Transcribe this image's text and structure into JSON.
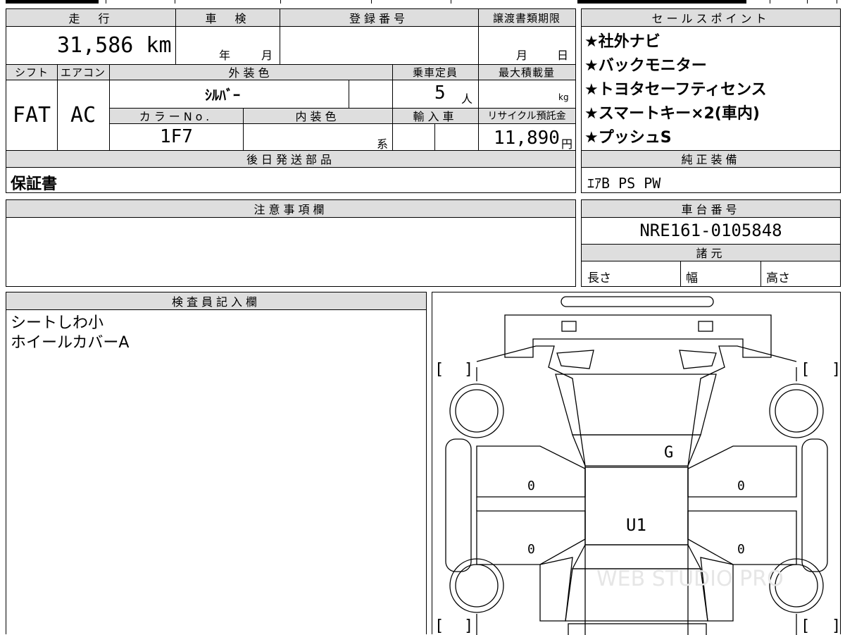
{
  "top_strip": {
    "dark_tab": ""
  },
  "vehicle": {
    "mileage_label": "走　行",
    "mileage_value": "31,586 km",
    "inspection_label": "車　検",
    "inspection_year_unit": "年",
    "inspection_month_unit": "月",
    "registration_label": "登録番号",
    "registration_value": "",
    "transfer_label": "譲渡書類期限",
    "transfer_month_unit": "月",
    "transfer_day_unit": "日",
    "shift_label": "シフト",
    "shift_value": "FAT",
    "aircon_label": "エアコン",
    "aircon_value": "AC",
    "exterior_label": "外装色",
    "exterior_value": "ｼﾙﾊﾞｰ",
    "capacity_label": "乗車定員",
    "capacity_value": "5",
    "capacity_unit": "人",
    "max_load_label": "最大積載量",
    "max_load_unit": "kg",
    "color_no_label": "カラーNo.",
    "color_no_value": "1F7",
    "interior_label": "内装色",
    "interior_suffix": "系",
    "import_label": "輸入車",
    "recycle_label": "リサイクル預託金",
    "recycle_value": "11,890",
    "recycle_unit": "円",
    "later_parts_label": "後日発送部品",
    "later_parts_value": "保証書"
  },
  "sales_points": {
    "label": "セールスポイント",
    "items": [
      "★社外ナビ",
      "★バックモニター",
      "★トヨタセーフティセンス",
      "★スマートキー×2(車内)",
      "★プッシュS"
    ]
  },
  "standard_equipment": {
    "label": "純正装備",
    "value": "ｴｱB PS PW"
  },
  "notes": {
    "label": "注意事項欄",
    "value": ""
  },
  "chassis": {
    "label": "車台番号",
    "value": "NRE161-0105848",
    "specs_label": "諸元",
    "length_label": "長さ",
    "width_label": "幅",
    "height_label": "高さ"
  },
  "inspector": {
    "label": "検査員記入欄",
    "lines": [
      "シートしわ小",
      "ホイールカバーA"
    ]
  },
  "diagram": {
    "marks": {
      "hood": "G",
      "roof": "U1",
      "left_front_door": "0",
      "left_rear_door": "0",
      "right_front_door": "0",
      "right_rear_door": "0"
    },
    "bracket_left": "[",
    "bracket_right": "]",
    "watermark": "WEB STUDIO PRO"
  }
}
